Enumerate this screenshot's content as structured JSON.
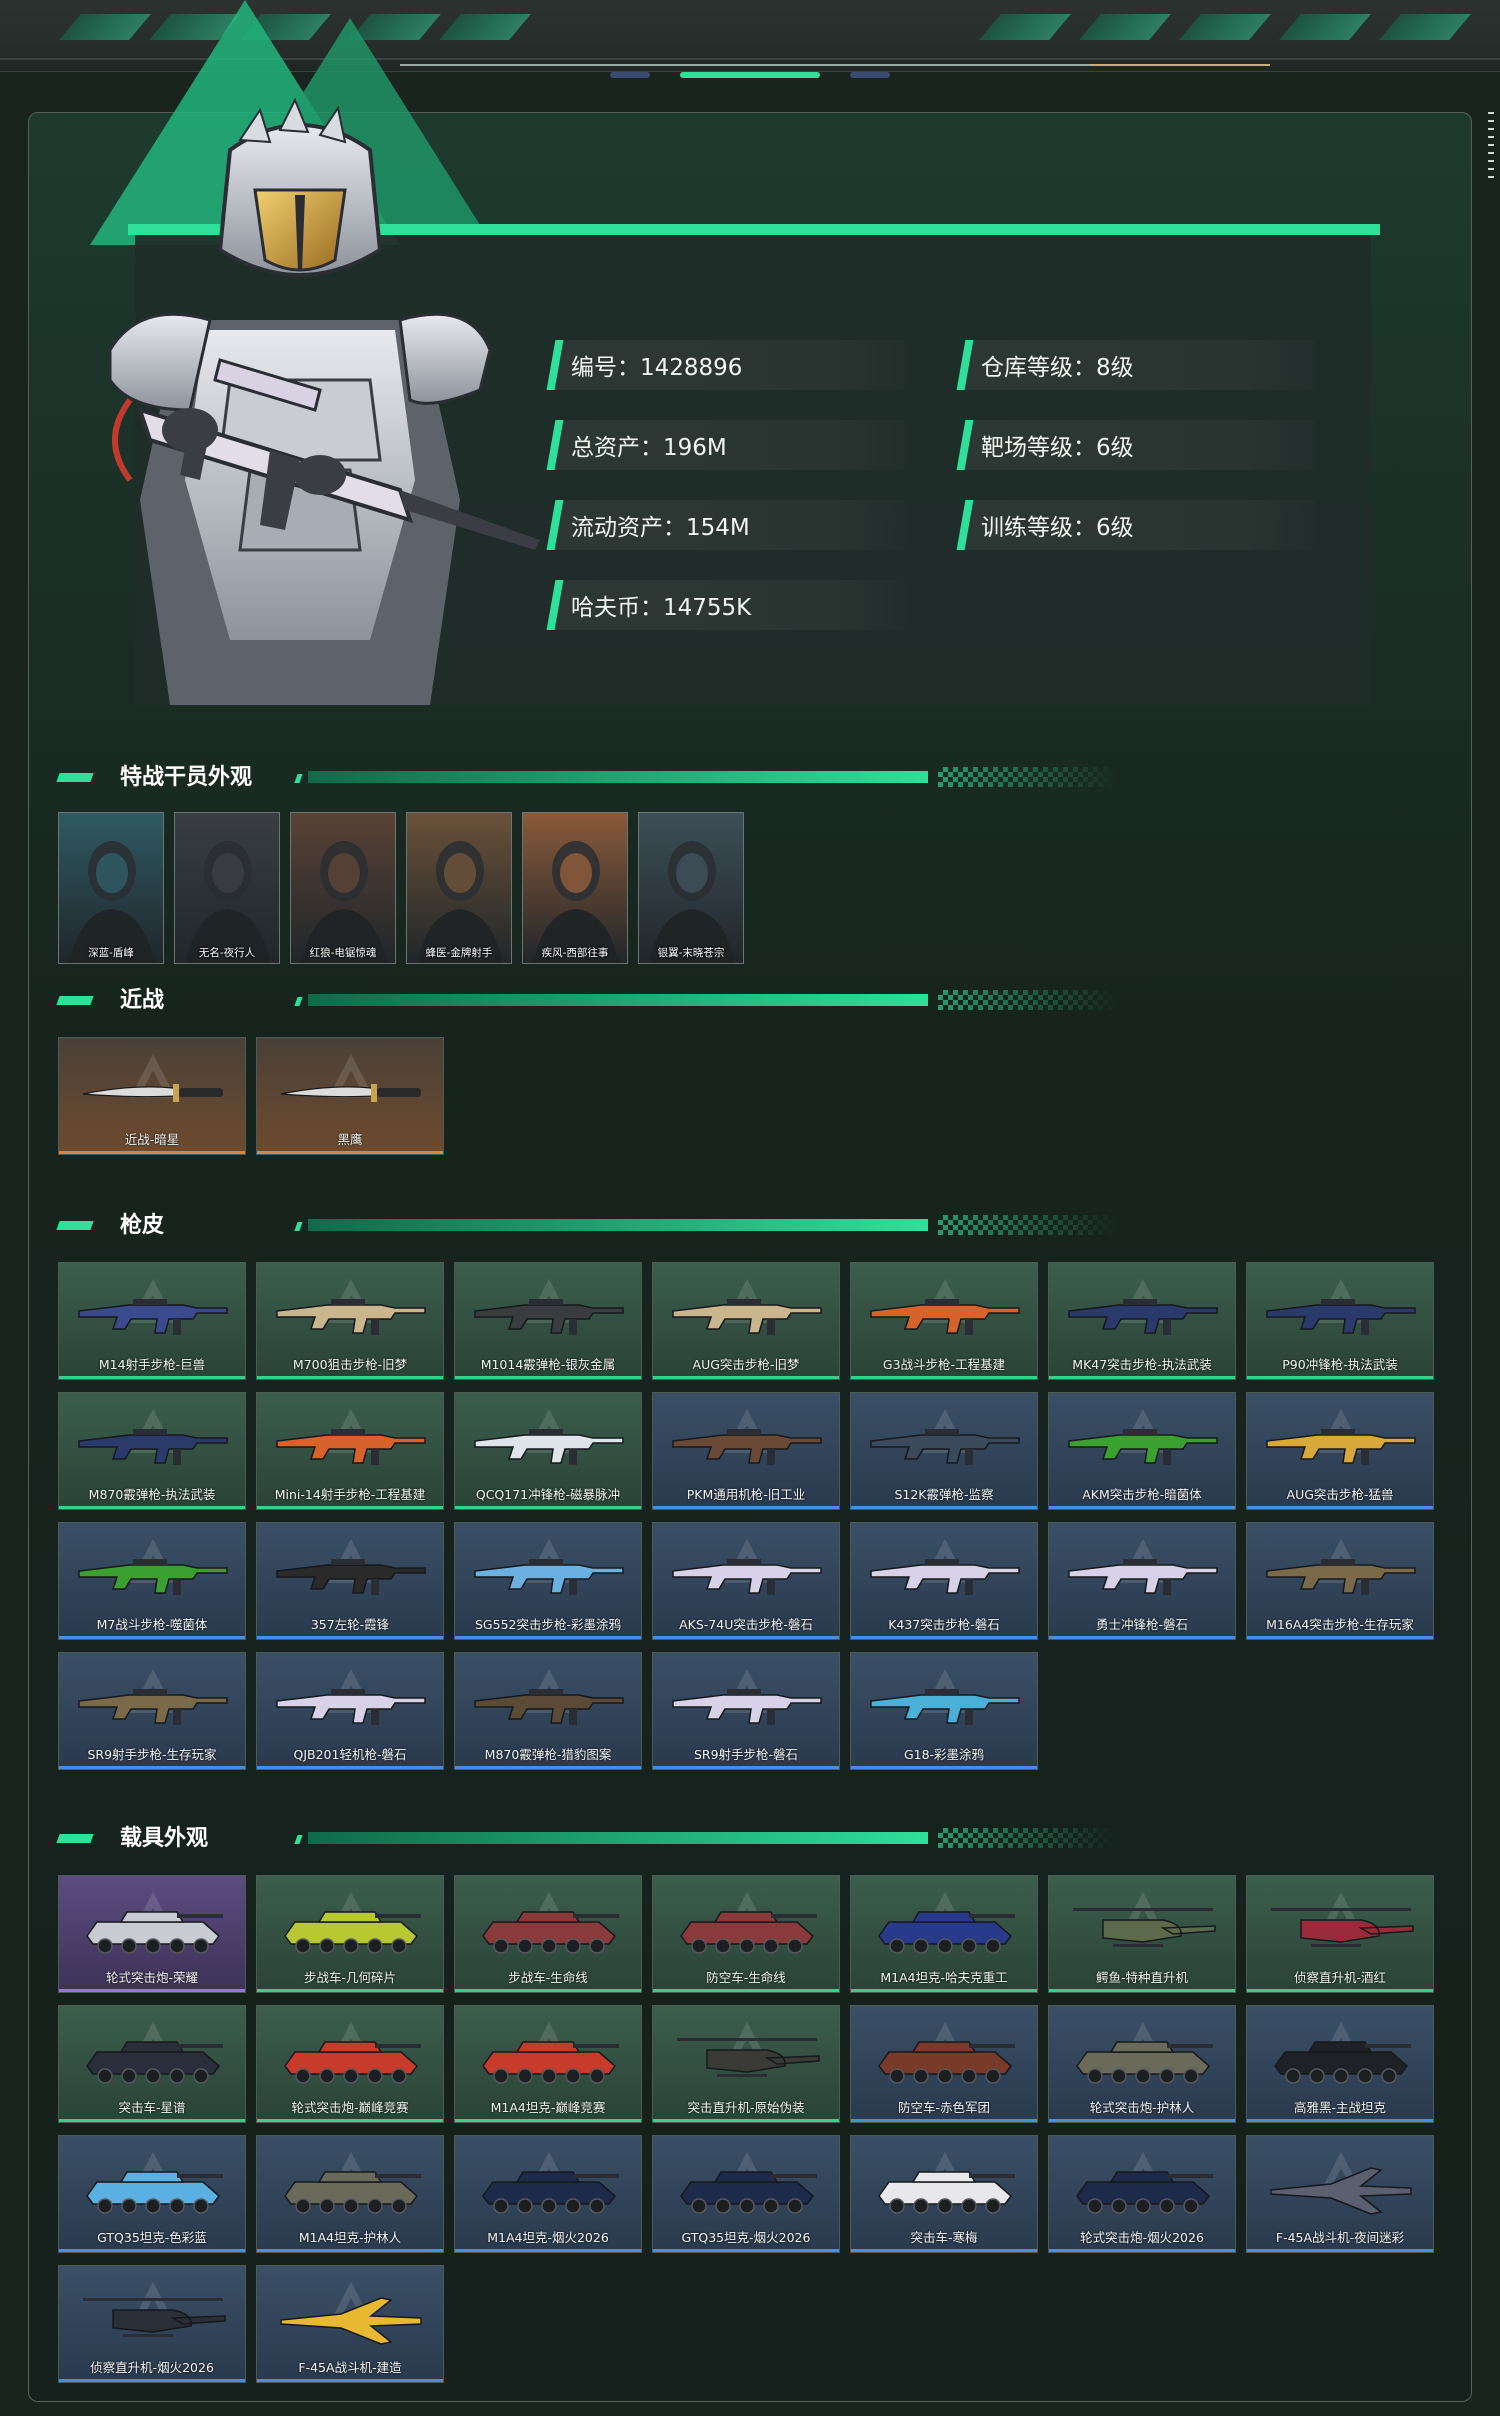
{
  "colors": {
    "accent": "#2ee09a",
    "panel_bg": "#1e2a26",
    "common": "#35d08a",
    "rare": "#4a8ee0",
    "epic": "#9a74e6",
    "melee": "#e0843a"
  },
  "stats": [
    {
      "label": "编号：1428896"
    },
    {
      "label": "仓库等级：8级"
    },
    {
      "label": "总资产：196M"
    },
    {
      "label": "靶场等级：6级"
    },
    {
      "label": "流动资产：154M"
    },
    {
      "label": "训练等级：6级"
    },
    {
      "label": "哈夫币：14755K"
    }
  ],
  "sections": {
    "operators": "特战干员外观",
    "melee": "近战",
    "gun_skins": "枪皮",
    "vehicles": "载具外观"
  },
  "operators": [
    {
      "label": "深蓝-盾峰",
      "bg": "#2f5a63"
    },
    {
      "label": "无名-夜行人",
      "bg": "#3a3e42"
    },
    {
      "label": "红狼-电锯惊魂",
      "bg": "#5a4336"
    },
    {
      "label": "蜂医-金牌射手",
      "bg": "#6a5138"
    },
    {
      "label": "疾风-西部往事",
      "bg": "#8a5a3a"
    },
    {
      "label": "银翼-末晓苍宗",
      "bg": "#3e4f58"
    }
  ],
  "melee": [
    {
      "label": "近战-暗星",
      "rarity": "orange"
    },
    {
      "label": "黑鹰",
      "rarity": "orange"
    }
  ],
  "gun_skins": [
    {
      "label": "M14射手步枪-巨兽",
      "rarity": "green",
      "color": "#3b4a8c"
    },
    {
      "label": "M700狙击步枪-旧梦",
      "rarity": "green",
      "color": "#c9b68c"
    },
    {
      "label": "M1014霰弹枪-银灰金属",
      "rarity": "green",
      "color": "#3a3d40"
    },
    {
      "label": "AUG突击步枪-旧梦",
      "rarity": "green",
      "color": "#c9b68c"
    },
    {
      "label": "G3战斗步枪-工程基建",
      "rarity": "green",
      "color": "#d8632a"
    },
    {
      "label": "MK47突击步枪-执法武装",
      "rarity": "green",
      "color": "#2a3a6a"
    },
    {
      "label": "P90冲锋枪-执法武装",
      "rarity": "green",
      "color": "#2a3a6a"
    },
    {
      "label": "M870霰弹枪-执法武装",
      "rarity": "green",
      "color": "#2a3a6a"
    },
    {
      "label": "Mini-14射手步枪-工程基建",
      "rarity": "green",
      "color": "#d8632a"
    },
    {
      "label": "QCQ171冲锋枪-磁暴脉冲",
      "rarity": "green",
      "color": "#dfe4ea"
    },
    {
      "label": "PKM通用机枪-旧工业",
      "rarity": "blue",
      "color": "#6a4a36"
    },
    {
      "label": "S12K霰弹枪-监察",
      "rarity": "blue",
      "color": "#3a4a5a"
    },
    {
      "label": "AKM突击步枪-暗菌体",
      "rarity": "blue",
      "color": "#3aa030"
    },
    {
      "label": "AUG突击步枪-猛兽",
      "rarity": "blue",
      "color": "#d9a83a"
    },
    {
      "label": "M7战斗步枪-噬菌体",
      "rarity": "blue",
      "color": "#3aa030"
    },
    {
      "label": "357左轮-霞锋",
      "rarity": "blue",
      "color": "#2a2a2a"
    },
    {
      "label": "SG552突击步枪-彩墨涂鸦",
      "rarity": "blue",
      "color": "#6ab0e0"
    },
    {
      "label": "AKS-74U突击步枪-磐石",
      "rarity": "blue",
      "color": "#d8d2e8"
    },
    {
      "label": "K437突击步枪-磐石",
      "rarity": "blue",
      "color": "#d8d2e8"
    },
    {
      "label": "勇士冲锋枪-磐石",
      "rarity": "blue",
      "color": "#d8d2e8"
    },
    {
      "label": "M16A4突击步枪-生存玩家",
      "rarity": "blue",
      "color": "#7a6a4a"
    },
    {
      "label": "SR9射手步枪-生存玩家",
      "rarity": "blue",
      "color": "#7a6a4a"
    },
    {
      "label": "QJB201轻机枪-磐石",
      "rarity": "blue",
      "color": "#d8d2e8"
    },
    {
      "label": "M870霰弹枪-猎豹图案",
      "rarity": "blue",
      "color": "#5a4a36"
    },
    {
      "label": "SR9射手步枪-磐石",
      "rarity": "blue",
      "color": "#d8d2e8"
    },
    {
      "label": "G18-彩墨涂鸦",
      "rarity": "blue",
      "color": "#4ab0d8"
    }
  ],
  "vehicles": [
    {
      "label": "轮式突击炮-荣耀",
      "rarity": "purple",
      "color": "#c8ccd2"
    },
    {
      "label": "步战车-几何碎片",
      "rarity": "green",
      "color": "#b8c830"
    },
    {
      "label": "步战车-生命线",
      "rarity": "green",
      "color": "#8a3a3a"
    },
    {
      "label": "防空车-生命线",
      "rarity": "green",
      "color": "#8a3a3a"
    },
    {
      "label": "M1A4坦克-哈夫克重工",
      "rarity": "green",
      "color": "#2a3a8a"
    },
    {
      "label": "鳄鱼-特种直升机",
      "rarity": "green",
      "color": "#5a6a4a"
    },
    {
      "label": "侦察直升机-酒红",
      "rarity": "green",
      "color": "#9a2a3a"
    },
    {
      "label": "突击车-星谱",
      "rarity": "green",
      "color": "#2a2e3a"
    },
    {
      "label": "轮式突击炮-巅峰竞赛",
      "rarity": "green",
      "color": "#c83a2a"
    },
    {
      "label": "M1A4坦克-巅峰竞赛",
      "rarity": "green",
      "color": "#c83a2a"
    },
    {
      "label": "突击直升机-原始伪装",
      "rarity": "green",
      "color": "#3a3a36"
    },
    {
      "label": "防空车-赤色军团",
      "rarity": "blue",
      "color": "#7a3a2a"
    },
    {
      "label": "轮式突击炮-护林人",
      "rarity": "blue",
      "color": "#6a6a5a"
    },
    {
      "label": "高雅黑-主战坦克",
      "rarity": "blue",
      "color": "#1e2226"
    },
    {
      "label": "GTQ35坦克-色彩蓝",
      "rarity": "blue",
      "color": "#5ab0e0"
    },
    {
      "label": "M1A4坦克-护林人",
      "rarity": "blue",
      "color": "#6a6a5a"
    },
    {
      "label": "M1A4坦克-烟火2026",
      "rarity": "blue",
      "color": "#1e2a4a"
    },
    {
      "label": "GTQ35坦克-烟火2026",
      "rarity": "blue",
      "color": "#1e2a4a"
    },
    {
      "label": "突击车-寒梅",
      "rarity": "blue",
      "color": "#e8e8ec"
    },
    {
      "label": "轮式突击炮-烟火2026",
      "rarity": "blue",
      "color": "#1e2a4a"
    },
    {
      "label": "F-45A战斗机-夜间迷彩",
      "rarity": "blue",
      "color": "#5a6070"
    },
    {
      "label": "侦察直升机-烟火2026",
      "rarity": "blue",
      "color": "#2a2e36"
    },
    {
      "label": "F-45A战斗机-建造",
      "rarity": "blue",
      "color": "#e8b830"
    }
  ]
}
